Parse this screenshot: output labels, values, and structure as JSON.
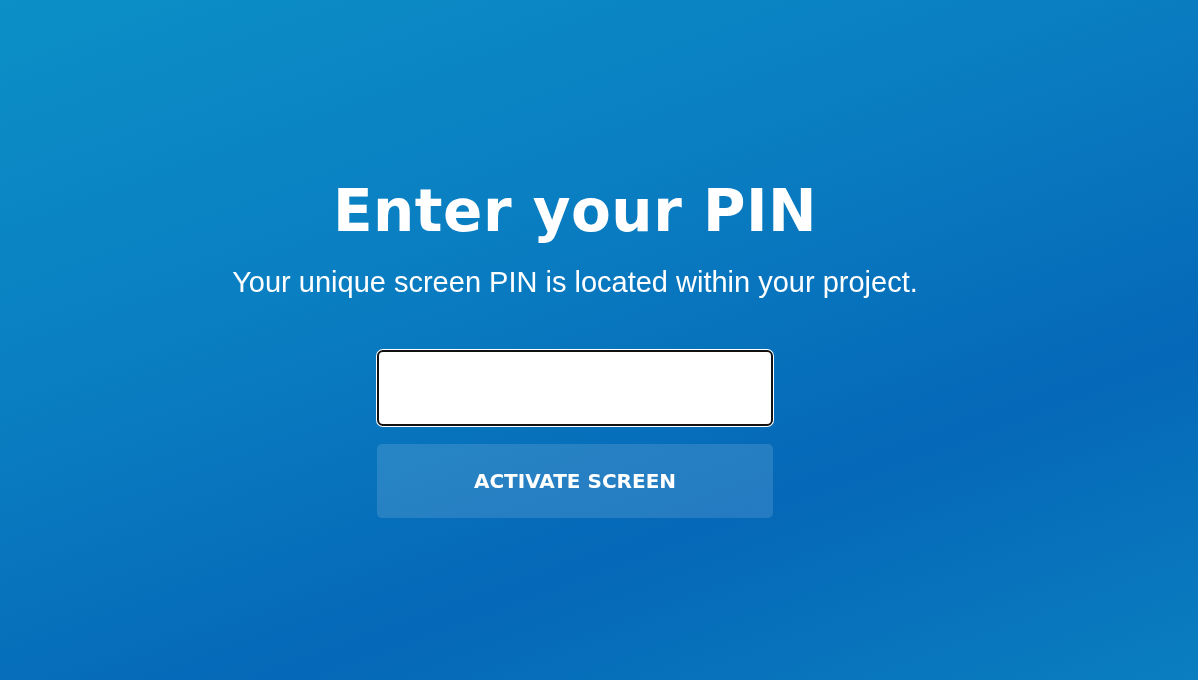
{
  "title": "Enter your PIN",
  "subtitle": "Your unique screen PIN is located within your project.",
  "button": {
    "label": "ACTIVATE SCREEN",
    "disabled": true
  }
}
